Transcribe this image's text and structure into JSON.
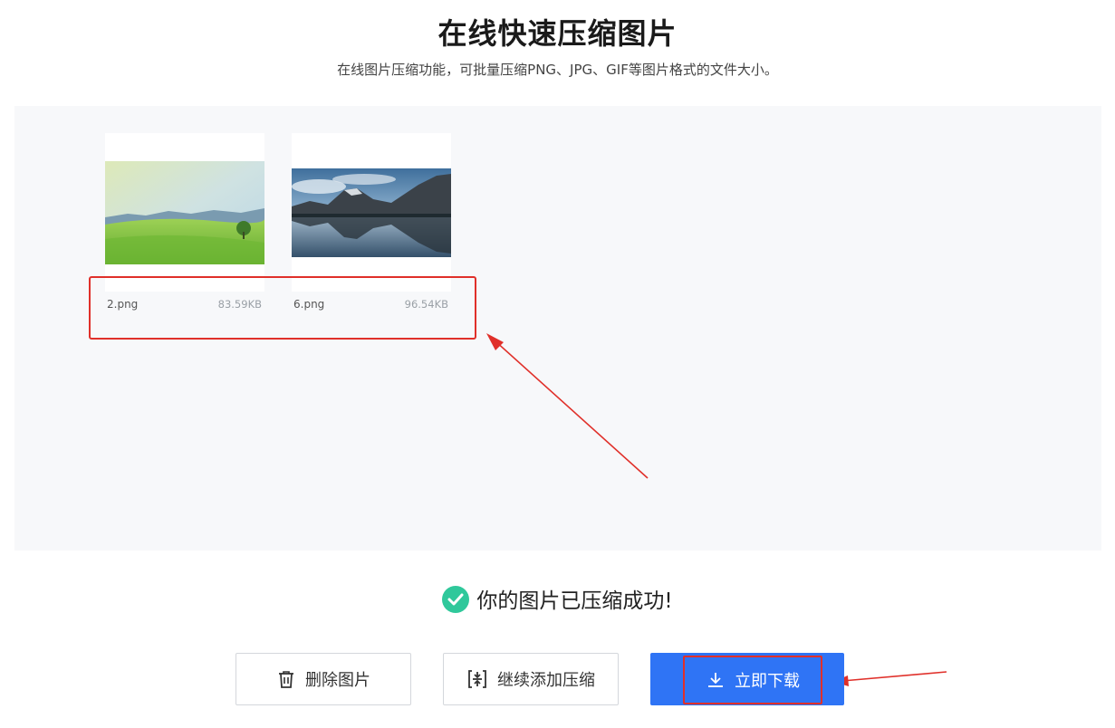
{
  "header": {
    "title": "在线快速压缩图片",
    "subtitle": "在线图片压缩功能，可批量压缩PNG、JPG、GIF等图片格式的文件大小。"
  },
  "files": [
    {
      "name": "2.png",
      "size": "83.59KB",
      "thumb": "green-meadow-landscape"
    },
    {
      "name": "6.png",
      "size": "96.54KB",
      "thumb": "mountain-lake-reflection"
    }
  ],
  "status": {
    "message": "你的图片已压缩成功!",
    "icon": "check-circle-icon"
  },
  "actions": {
    "delete_label": "删除图片",
    "add_label": "继续添加压缩",
    "download_label": "立即下载"
  },
  "colors": {
    "accent": "#2f74f5",
    "success": "#2fc89b",
    "annotation": "#e0302a",
    "panel_bg": "#f7f8fa"
  }
}
